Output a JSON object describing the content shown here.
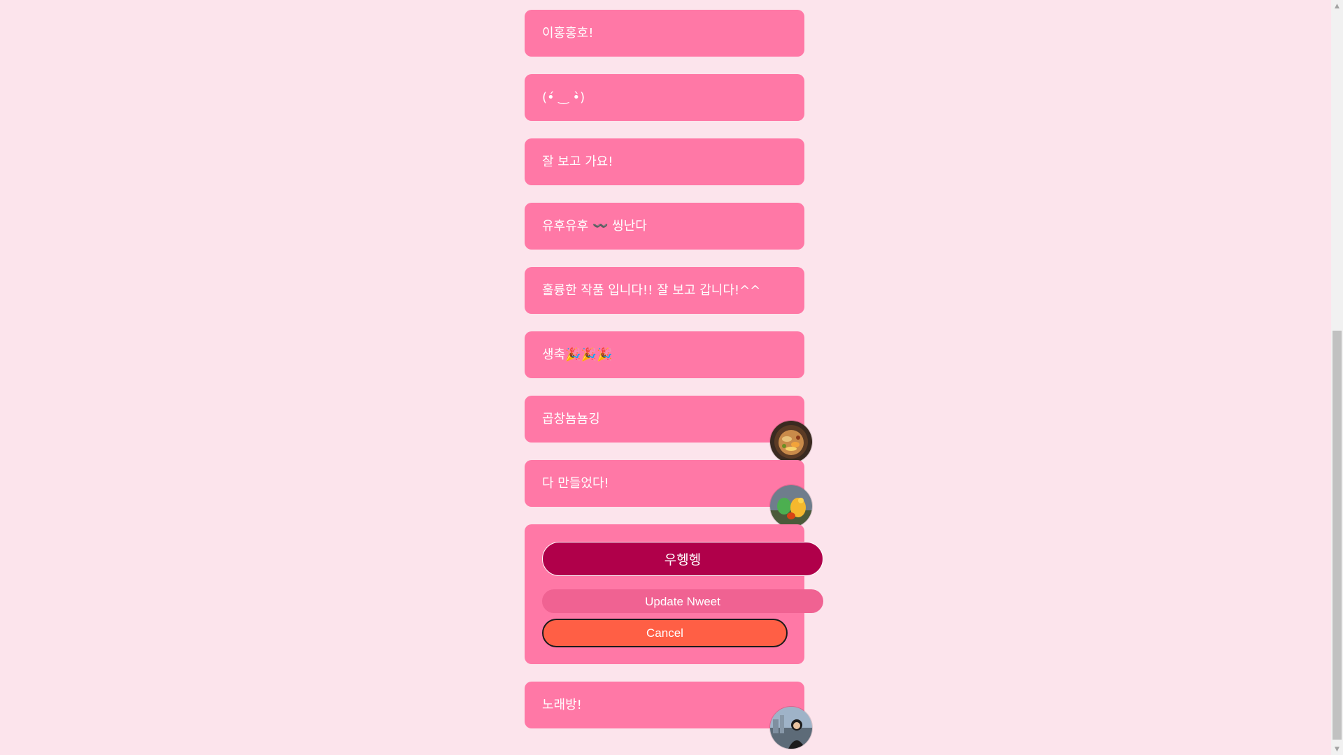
{
  "nweets": [
    {
      "text": "이홍홍호!",
      "has_attachment": false
    },
    {
      "text": "(•́ ‿ •̀)",
      "has_attachment": false
    },
    {
      "text": "잘 보고 가요!",
      "has_attachment": false
    },
    {
      "text": "유후유후 〰️ 씽난다",
      "has_attachment": false
    },
    {
      "text": "훌륭한 작품 입니다!! 잘 보고 갑니다!^^",
      "has_attachment": false
    },
    {
      "text": "생축🎉🎉🎉",
      "has_attachment": false
    },
    {
      "text": "곱창뇸뇸깅",
      "has_attachment": true,
      "attachment": "food-photo"
    },
    {
      "text": "다 만들었다!",
      "has_attachment": true,
      "attachment": "craft-photo"
    }
  ],
  "edit": {
    "value": "우헹헹",
    "update_label": "Update Nweet",
    "cancel_label": "Cancel"
  },
  "last_nweet": {
    "text": "노래방!",
    "has_attachment": true,
    "attachment": "person-photo"
  },
  "colors": {
    "background": "#fce4ec",
    "card": "#ff78a6",
    "input": "#b0004a",
    "update": "#f06292",
    "cancel": "#ff5f45"
  },
  "scrollbar": {
    "up_icon": "triangle-up-icon",
    "down_icon": "triangle-down-icon"
  }
}
